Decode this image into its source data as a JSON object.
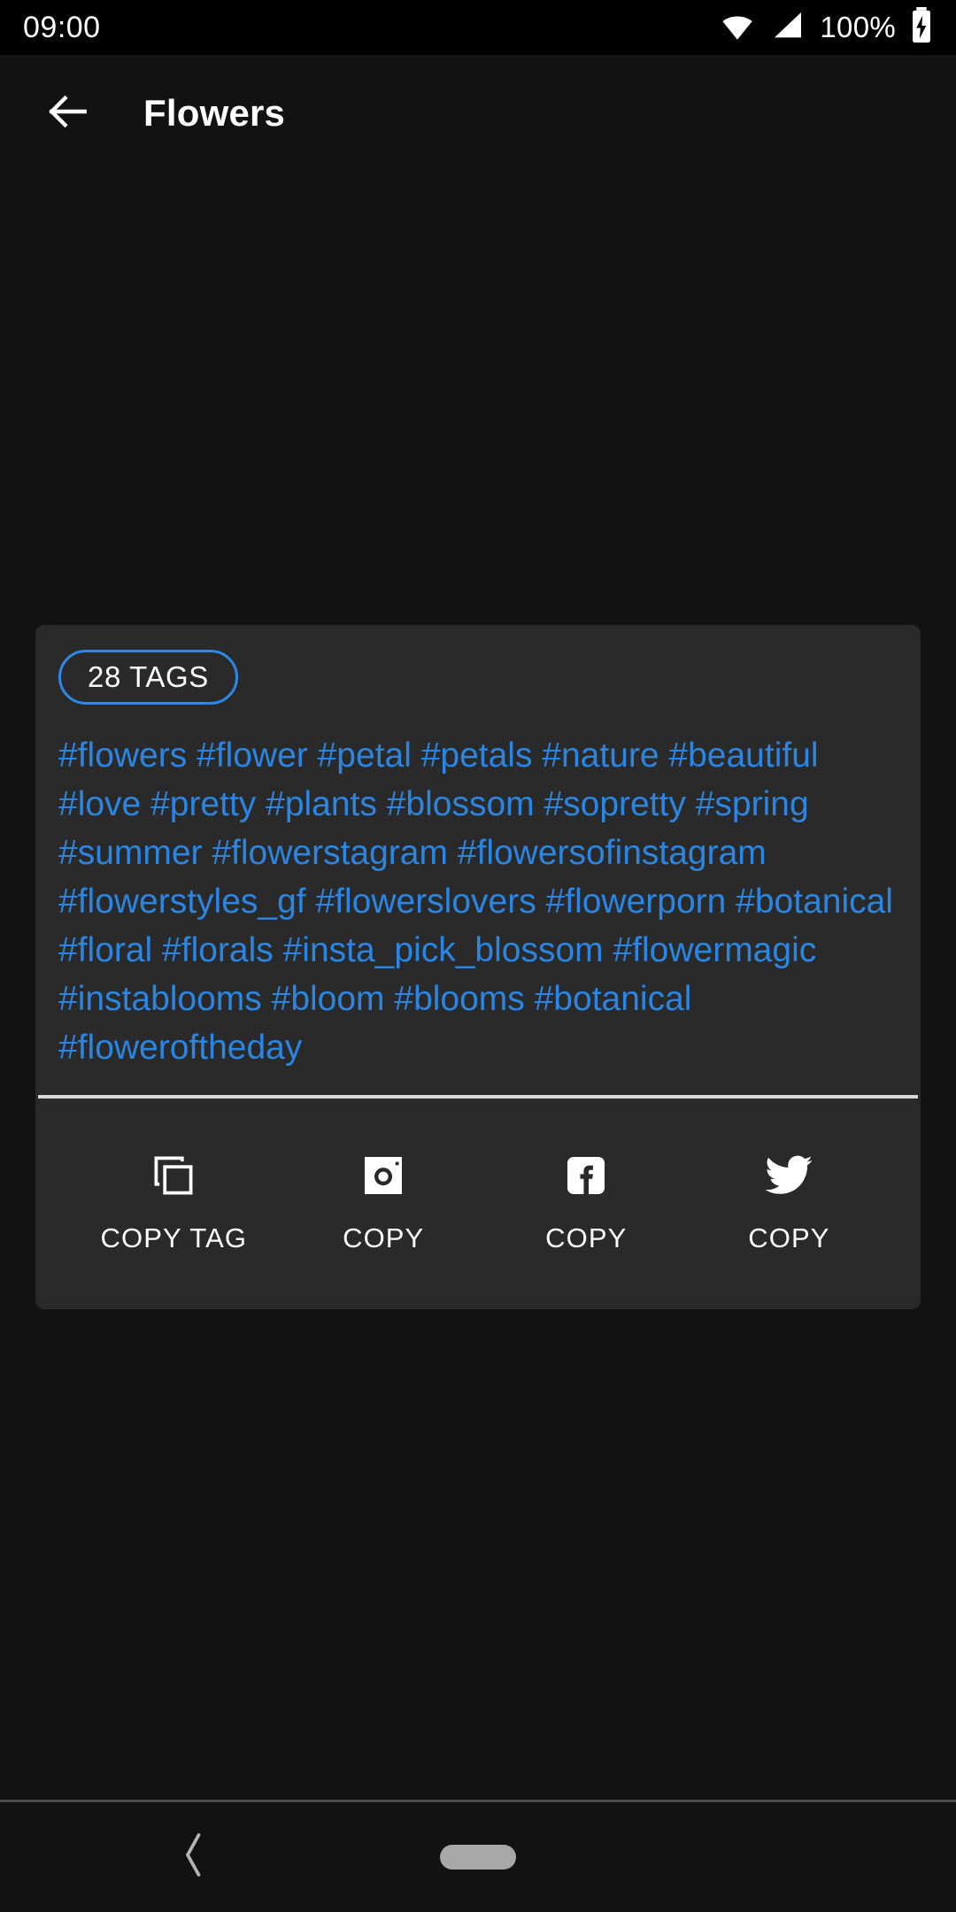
{
  "status_bar": {
    "time": "09:00",
    "battery_text": "100%",
    "icons": [
      "wifi-icon",
      "cellular-signal-icon",
      "battery-charging-icon"
    ]
  },
  "toolbar": {
    "back_icon": "arrow-back-icon",
    "title": "Flowers"
  },
  "tag_card": {
    "count_badge": "28 TAGS",
    "tags_text": "#flowers #flower #petal #petals #nature #beautiful #love #pretty #plants #blossom #sopretty #spring #summer #flowerstagram #flowersofinstagram #flowerstyles_gf #flowerslovers #flowerporn #botanical #floral #florals #insta_pick_blossom #flowermagic #instablooms #bloom #blooms #botanical #floweroftheday",
    "tags": [
      "#flowers",
      "#flower",
      "#petal",
      "#petals",
      "#nature",
      "#beautiful",
      "#love",
      "#pretty",
      "#plants",
      "#blossom",
      "#sopretty",
      "#spring",
      "#summer",
      "#flowerstagram",
      "#flowersofinstagram",
      "#flowerstyles_gf",
      "#flowerslovers",
      "#flowerporn",
      "#botanical",
      "#floral",
      "#florals",
      "#insta_pick_blossom",
      "#flowermagic",
      "#instablooms",
      "#bloom",
      "#blooms",
      "#botanical",
      "#floweroftheday"
    ],
    "actions": [
      {
        "icon": "copy-icon",
        "label": "COPY TAG"
      },
      {
        "icon": "instagram-icon",
        "label": "COPY"
      },
      {
        "icon": "facebook-icon",
        "label": "COPY"
      },
      {
        "icon": "twitter-icon",
        "label": "COPY"
      }
    ]
  },
  "nav_bar": {
    "back_icon": "chevron-back-icon",
    "home_indicator": "home-pill-indicator"
  },
  "colors": {
    "background": "#121212",
    "card": "#2a2a2a",
    "accent_blue": "#2f88e5",
    "tag_text": "#2b86e3",
    "divider": "#d8d8d8",
    "on_surface": "#ffffff"
  }
}
